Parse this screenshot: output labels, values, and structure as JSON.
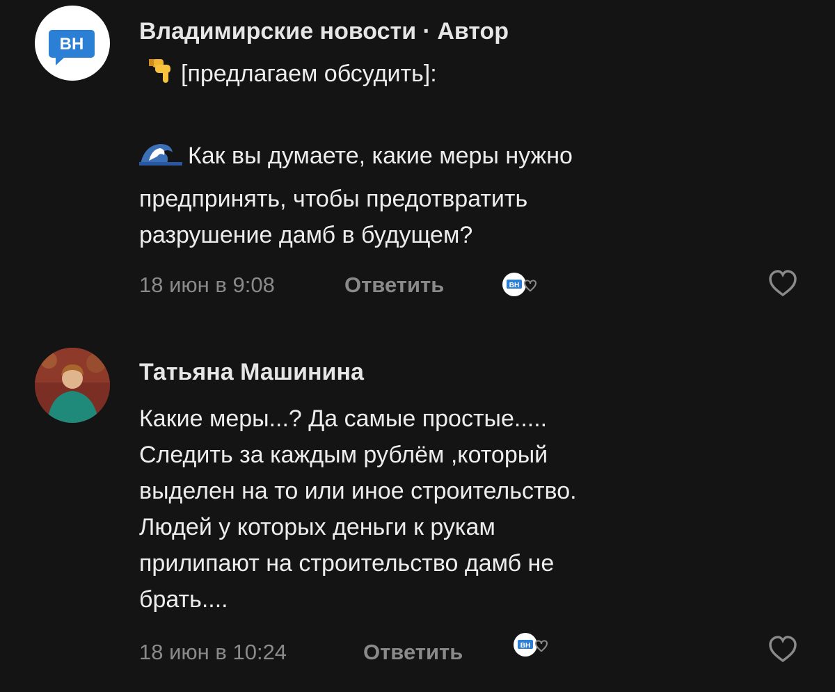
{
  "comments": [
    {
      "author_name": "Владимирские новости",
      "author_badge": "· Автор",
      "avatar_initials": "ВН",
      "lines": [
        "[предлагаем обсудить]:",
        "",
        "Как вы думаете, какие меры нужно",
        "предпринять, чтобы предотвратить",
        "разрушение дамб в будущем?"
      ],
      "timestamp": "18 июн в 9:08",
      "reply_label": "Ответить",
      "liked_by_initials": "ВН"
    },
    {
      "author_name": "Татьяна Машинина",
      "lines": [
        "Какие меры...? Да самые простые.....",
        "Следить за каждым рублём ,который",
        "выделен на то или иное строительство.",
        "Людей у которых деньги к рукам",
        "прилипают на строительство дамб не",
        "брать...."
      ],
      "timestamp": "18 июн в 10:24",
      "reply_label": "Ответить",
      "liked_by_initials": "ВН"
    }
  ],
  "icons": {
    "pointing_down": "backhand-index-pointing-down-icon",
    "wave": "water-wave-icon",
    "like": "heart-icon"
  },
  "colors": {
    "background": "#141414",
    "brand_blue": "#2b7fd4",
    "muted_text": "#8a8a8a"
  }
}
